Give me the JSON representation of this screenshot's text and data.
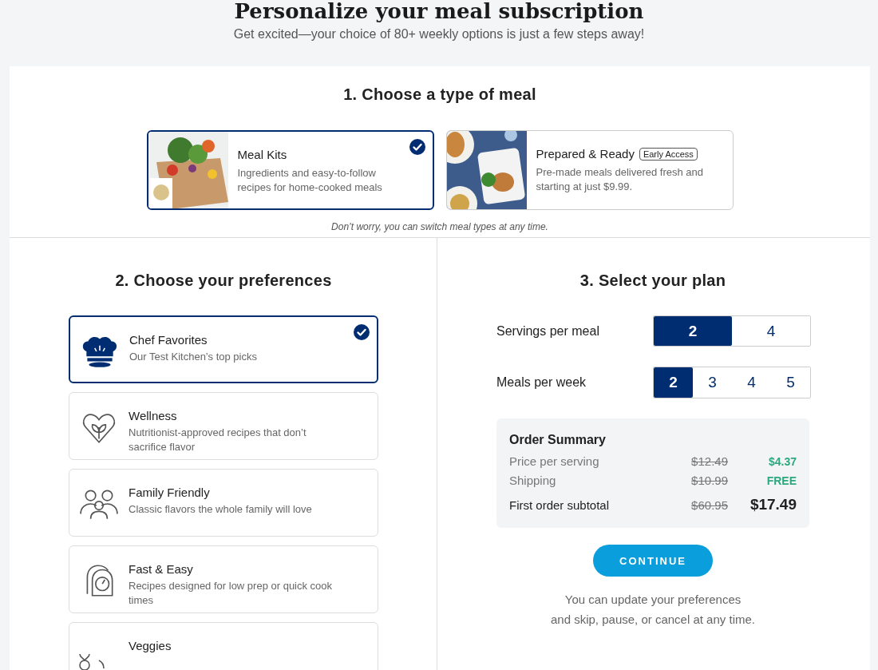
{
  "header": {
    "title": "Personalize your meal subscription",
    "subtitle": "Get excited—your choice of 80+ weekly options is just a few steps away!"
  },
  "meal_type": {
    "title": "1. Choose a type of meal",
    "options": [
      {
        "kind": "picture",
        "name": "Meal Kits",
        "description": "Ingredients and easy-to-follow recipes for home-cooked meals",
        "selected": true
      },
      {
        "kind": "picture",
        "name": "Prepared & Ready",
        "badge": "Early Access",
        "description": "Pre-made meals delivered fresh and starting at just $9.99.",
        "selected": false
      }
    ],
    "note": "Don’t worry, you can switch meal types at any time."
  },
  "preferences": {
    "title": "2. Choose your preferences",
    "items": [
      {
        "name": "Chef Favorites",
        "description": "Our Test Kitchen’s top picks",
        "selected": true
      },
      {
        "name": "Wellness",
        "description": "Nutritionist-approved recipes that don’t sacrifice flavor",
        "selected": false
      },
      {
        "name": "Family Friendly",
        "description": "Classic flavors the whole family will love",
        "selected": false
      },
      {
        "name": "Fast & Easy",
        "description": "Recipes designed for low prep or quick cook times",
        "selected": false
      },
      {
        "name": "Veggies",
        "selected": false
      }
    ]
  },
  "plan": {
    "title": "3. Select your plan",
    "servings": {
      "label": "Servings per meal",
      "options": [
        {
          "label": "2",
          "selected": true
        },
        {
          "label": "4",
          "selected": false
        }
      ]
    },
    "meals": {
      "label": "Meals per week",
      "options": [
        {
          "label": "2",
          "selected": true
        },
        {
          "label": "3",
          "selected": false
        },
        {
          "label": "4",
          "selected": false
        },
        {
          "label": "5",
          "selected": false
        }
      ]
    },
    "summary": {
      "title": "Order Summary",
      "rows": [
        {
          "label": "Price per serving",
          "old_price": "$12.49",
          "price": "$4.37",
          "kind": "discount"
        },
        {
          "label": "Shipping",
          "old_price": "$10.99",
          "price": "FREE",
          "kind": "discount"
        },
        {
          "label": "First order subtotal",
          "old_price": "$60.95",
          "price": "$17.49",
          "kind": "total"
        }
      ]
    },
    "continue_button": "CONTINUE",
    "footnote_lines": [
      "You can update your preferences",
      "and skip, pause, or cancel at any time."
    ]
  }
}
